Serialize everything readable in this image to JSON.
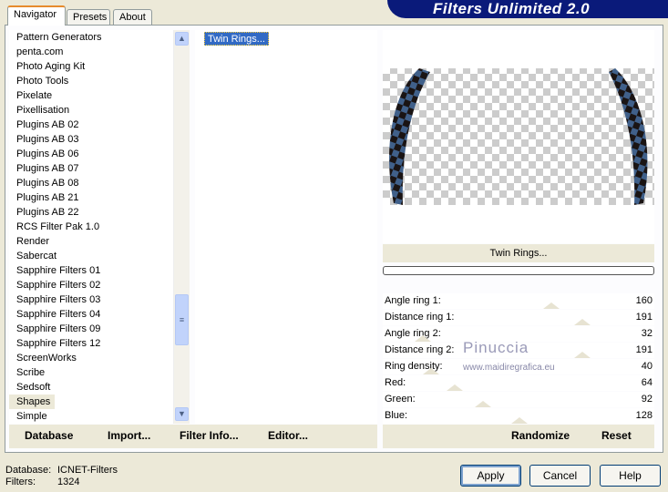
{
  "tabs": [
    "Navigator",
    "Presets",
    "About"
  ],
  "brand": "Filters Unlimited 2.0",
  "categories": [
    "Pattern Generators",
    "penta.com",
    "Photo Aging Kit",
    "Photo Tools",
    "Pixelate",
    "Pixellisation",
    "Plugins AB 02",
    "Plugins AB 03",
    "Plugins AB 06",
    "Plugins AB 07",
    "Plugins AB 08",
    "Plugins AB 21",
    "Plugins AB 22",
    "RCS Filter Pak 1.0",
    "Render",
    "Sabercat",
    "Sapphire Filters 01",
    "Sapphire Filters 02",
    "Sapphire Filters 03",
    "Sapphire Filters 04",
    "Sapphire Filters 09",
    "Sapphire Filters 12",
    "ScreenWorks",
    "Scribe",
    "Sedsoft",
    "Shapes",
    "Simple"
  ],
  "selected_category": "Shapes",
  "filters": [
    "Twin Rings..."
  ],
  "filter_title": "Twin Rings...",
  "progress": 0,
  "sliders": [
    {
      "label": "Angle ring 1:",
      "value": 160
    },
    {
      "label": "Distance ring 1:",
      "value": 191
    },
    {
      "label": "Angle ring 2:",
      "value": 32
    },
    {
      "label": "Distance ring 2:",
      "value": 191
    },
    {
      "label": "Ring density:",
      "value": 40
    },
    {
      "label": "Red:",
      "value": 64
    },
    {
      "label": "Green:",
      "value": 92
    },
    {
      "label": "Blue:",
      "value": 128
    }
  ],
  "slider_max": 255,
  "watermark": {
    "name": "Pinuccia",
    "url": "www.maidiregrafica.eu"
  },
  "bottom_buttons": {
    "database": "Database",
    "import": "Import...",
    "filter_info": "Filter Info...",
    "editor": "Editor...",
    "randomize": "Randomize",
    "reset": "Reset"
  },
  "footer": {
    "database_label": "Database:",
    "database_value": "ICNET-Filters",
    "filters_label": "Filters:",
    "filters_value": "1324"
  },
  "actions": {
    "apply": "Apply",
    "cancel": "Cancel",
    "help": "Help"
  },
  "colors": {
    "accent": "#316ac5",
    "ring_blue": "#40608a",
    "ring_dark": "#1a1414"
  }
}
